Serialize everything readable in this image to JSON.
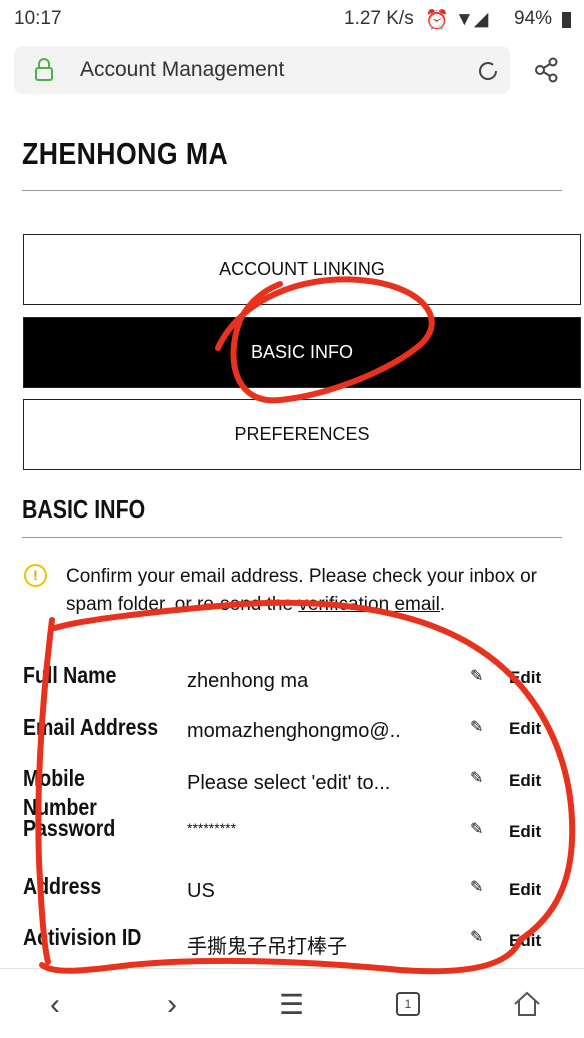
{
  "status_bar": {
    "time": "10:17",
    "speed": "1.27 K/s",
    "battery": "94%"
  },
  "browser": {
    "address_title": "Account Management",
    "tab_count": "1"
  },
  "page": {
    "title": "ZHENHONG MA",
    "tabs": [
      {
        "label": "ACCOUNT LINKING"
      },
      {
        "label": "BASIC INFO"
      },
      {
        "label": "PREFERENCES"
      }
    ],
    "section_title": "BASIC INFO",
    "notice": {
      "text": "Confirm your email address. Please check your inbox or spam folder, or re-send the ",
      "link": "verification email",
      "end": "."
    },
    "rows": [
      {
        "label": "Full Name",
        "value": "zhenhong ma",
        "edit": "Edit"
      },
      {
        "label": "Email Address",
        "value": "momazhenghongmo@..",
        "edit": "Edit"
      },
      {
        "label": "Mobile Number",
        "value": "Please select 'edit' to...",
        "edit": "Edit"
      },
      {
        "label": "Password",
        "value": "*********",
        "edit": "Edit"
      },
      {
        "label": "Address",
        "value": "US",
        "edit": "Edit"
      },
      {
        "label": "Activision ID",
        "value": "手撕鬼子吊打棒子",
        "edit": "Edit"
      }
    ]
  },
  "colors": {
    "annotation": "#e8321e",
    "lock": "#4caf50",
    "warning": "#f2c200"
  }
}
